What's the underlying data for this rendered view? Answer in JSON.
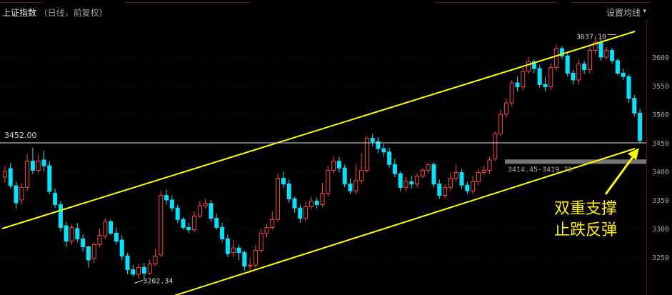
{
  "header": {
    "title": "上证指数",
    "subtitle": "(日线，前复权)",
    "ma_settings": "设置均线"
  },
  "colors": {
    "up": "#ff4444",
    "down": "#00e5ff",
    "channel": "#ffff00",
    "axis_text": "#a0a0a0",
    "reference_line": "#e0e0e0"
  },
  "annotation": {
    "line1": "双重支撑",
    "line2": "止跌反弹"
  },
  "chart_data": {
    "type": "candlestick",
    "title": "上证指数",
    "y_ticks": [
      3250,
      3300,
      3350,
      3400,
      3450,
      3500,
      3550,
      3600
    ],
    "ylim": [
      3194,
      3660
    ],
    "grid": true,
    "reference_line": {
      "value": 3450,
      "label": "3452.00"
    },
    "gap_zone": {
      "low": 3414.45,
      "high": 3419.73,
      "label": "3414.45-3419.73"
    },
    "labels": {
      "high": "3637.10",
      "low": "3202.34"
    },
    "channel": {
      "upper": [
        [
          0,
          3300
        ],
        [
          71,
          3645
        ]
      ],
      "lower": [
        [
          24,
          3194
        ],
        [
          71,
          3440
        ]
      ]
    },
    "candles": [
      [
        3390,
        3400,
        3380,
        3410
      ],
      [
        3405,
        3375,
        3370,
        3415
      ],
      [
        3375,
        3345,
        3335,
        3382
      ],
      [
        3350,
        3372,
        3342,
        3380
      ],
      [
        3372,
        3418,
        3366,
        3430
      ],
      [
        3418,
        3402,
        3395,
        3442
      ],
      [
        3402,
        3418,
        3396,
        3430
      ],
      [
        3420,
        3410,
        3400,
        3436
      ],
      [
        3410,
        3365,
        3360,
        3418
      ],
      [
        3362,
        3342,
        3336,
        3370
      ],
      [
        3342,
        3302,
        3295,
        3348
      ],
      [
        3305,
        3278,
        3268,
        3312
      ],
      [
        3278,
        3302,
        3272,
        3306
      ],
      [
        3300,
        3282,
        3276,
        3310
      ],
      [
        3282,
        3268,
        3260,
        3290
      ],
      [
        3268,
        3245,
        3232,
        3270
      ],
      [
        3248,
        3272,
        3240,
        3276
      ],
      [
        3272,
        3288,
        3268,
        3300
      ],
      [
        3287,
        3312,
        3282,
        3318
      ],
      [
        3312,
        3292,
        3288,
        3316
      ],
      [
        3292,
        3278,
        3272,
        3302
      ],
      [
        3280,
        3252,
        3244,
        3288
      ],
      [
        3252,
        3228,
        3220,
        3258
      ],
      [
        3228,
        3220,
        3216,
        3236
      ],
      [
        3220,
        3232,
        3212,
        3238
      ],
      [
        3232,
        3222,
        3210,
        3240
      ],
      [
        3222,
        3238,
        3218,
        3246
      ],
      [
        3238,
        3252,
        3235,
        3264
      ],
      [
        3254,
        3358,
        3250,
        3366
      ],
      [
        3358,
        3350,
        3342,
        3368
      ],
      [
        3350,
        3336,
        3330,
        3358
      ],
      [
        3336,
        3316,
        3310,
        3342
      ],
      [
        3316,
        3302,
        3298,
        3320
      ],
      [
        3302,
        3298,
        3292,
        3310
      ],
      [
        3298,
        3322,
        3294,
        3330
      ],
      [
        3322,
        3340,
        3318,
        3348
      ],
      [
        3340,
        3344,
        3335,
        3352
      ],
      [
        3344,
        3318,
        3312,
        3350
      ],
      [
        3318,
        3302,
        3298,
        3326
      ],
      [
        3302,
        3282,
        3276,
        3310
      ],
      [
        3282,
        3256,
        3250,
        3290
      ],
      [
        3258,
        3266,
        3250,
        3280
      ],
      [
        3266,
        3258,
        3245,
        3272
      ],
      [
        3258,
        3234,
        3226,
        3262
      ],
      [
        3234,
        3236,
        3222,
        3248
      ],
      [
        3236,
        3262,
        3230,
        3272
      ],
      [
        3262,
        3292,
        3258,
        3300
      ],
      [
        3292,
        3302,
        3284,
        3308
      ],
      [
        3302,
        3316,
        3298,
        3330
      ],
      [
        3316,
        3388,
        3312,
        3396
      ],
      [
        3388,
        3378,
        3370,
        3400
      ],
      [
        3378,
        3352,
        3345,
        3386
      ],
      [
        3352,
        3336,
        3328,
        3356
      ],
      [
        3336,
        3318,
        3310,
        3342
      ],
      [
        3318,
        3338,
        3312,
        3348
      ],
      [
        3338,
        3348,
        3334,
        3356
      ],
      [
        3348,
        3342,
        3335,
        3354
      ],
      [
        3342,
        3362,
        3338,
        3380
      ],
      [
        3362,
        3402,
        3356,
        3410
      ],
      [
        3402,
        3418,
        3396,
        3426
      ],
      [
        3418,
        3406,
        3398,
        3426
      ],
      [
        3406,
        3378,
        3372,
        3412
      ],
      [
        3378,
        3366,
        3360,
        3388
      ],
      [
        3366,
        3384,
        3360,
        3412
      ],
      [
        3384,
        3402,
        3378,
        3432
      ],
      [
        3402,
        3458,
        3398,
        3462
      ],
      [
        3458,
        3452,
        3444,
        3466
      ],
      [
        3452,
        3440,
        3432,
        3460
      ],
      [
        3440,
        3434,
        3426,
        3448
      ],
      [
        3434,
        3412,
        3406,
        3442
      ],
      [
        3412,
        3396,
        3390,
        3422
      ],
      [
        3396,
        3372,
        3365,
        3400
      ],
      [
        3372,
        3382,
        3366,
        3390
      ],
      [
        3382,
        3378,
        3370,
        3392
      ],
      [
        3378,
        3392,
        3372,
        3396
      ],
      [
        3392,
        3402,
        3388,
        3406
      ],
      [
        3402,
        3412,
        3396,
        3414
      ],
      [
        3412,
        3378,
        3372,
        3416
      ],
      [
        3378,
        3358,
        3352,
        3386
      ],
      [
        3358,
        3372,
        3354,
        3378
      ],
      [
        3372,
        3388,
        3366,
        3398
      ],
      [
        3388,
        3398,
        3382,
        3412
      ],
      [
        3398,
        3376,
        3370,
        3404
      ],
      [
        3376,
        3366,
        3360,
        3382
      ],
      [
        3366,
        3382,
        3360,
        3392
      ],
      [
        3382,
        3398,
        3376,
        3404
      ],
      [
        3398,
        3402,
        3394,
        3410
      ],
      [
        3402,
        3420,
        3396,
        3426
      ],
      [
        3422,
        3466,
        3418,
        3470
      ],
      [
        3466,
        3500,
        3462,
        3508
      ],
      [
        3500,
        3520,
        3494,
        3528
      ],
      [
        3520,
        3555,
        3514,
        3560
      ],
      [
        3555,
        3548,
        3540,
        3566
      ],
      [
        3548,
        3575,
        3542,
        3582
      ],
      [
        3575,
        3592,
        3570,
        3600
      ],
      [
        3592,
        3580,
        3572,
        3596
      ],
      [
        3580,
        3552,
        3546,
        3586
      ],
      [
        3552,
        3548,
        3540,
        3566
      ],
      [
        3548,
        3582,
        3542,
        3590
      ],
      [
        3582,
        3615,
        3576,
        3622
      ],
      [
        3615,
        3602,
        3596,
        3620
      ],
      [
        3602,
        3572,
        3566,
        3606
      ],
      [
        3572,
        3560,
        3552,
        3578
      ],
      [
        3560,
        3588,
        3552,
        3596
      ],
      [
        3588,
        3578,
        3570,
        3594
      ],
      [
        3578,
        3612,
        3572,
        3618
      ],
      [
        3612,
        3626,
        3604,
        3637
      ],
      [
        3626,
        3600,
        3594,
        3632
      ],
      [
        3600,
        3612,
        3596,
        3618
      ],
      [
        3612,
        3594,
        3588,
        3616
      ],
      [
        3594,
        3572,
        3568,
        3598
      ],
      [
        3572,
        3566,
        3560,
        3580
      ],
      [
        3566,
        3528,
        3520,
        3570
      ],
      [
        3528,
        3502,
        3496,
        3534
      ],
      [
        3502,
        3454,
        3450,
        3510
      ]
    ]
  }
}
